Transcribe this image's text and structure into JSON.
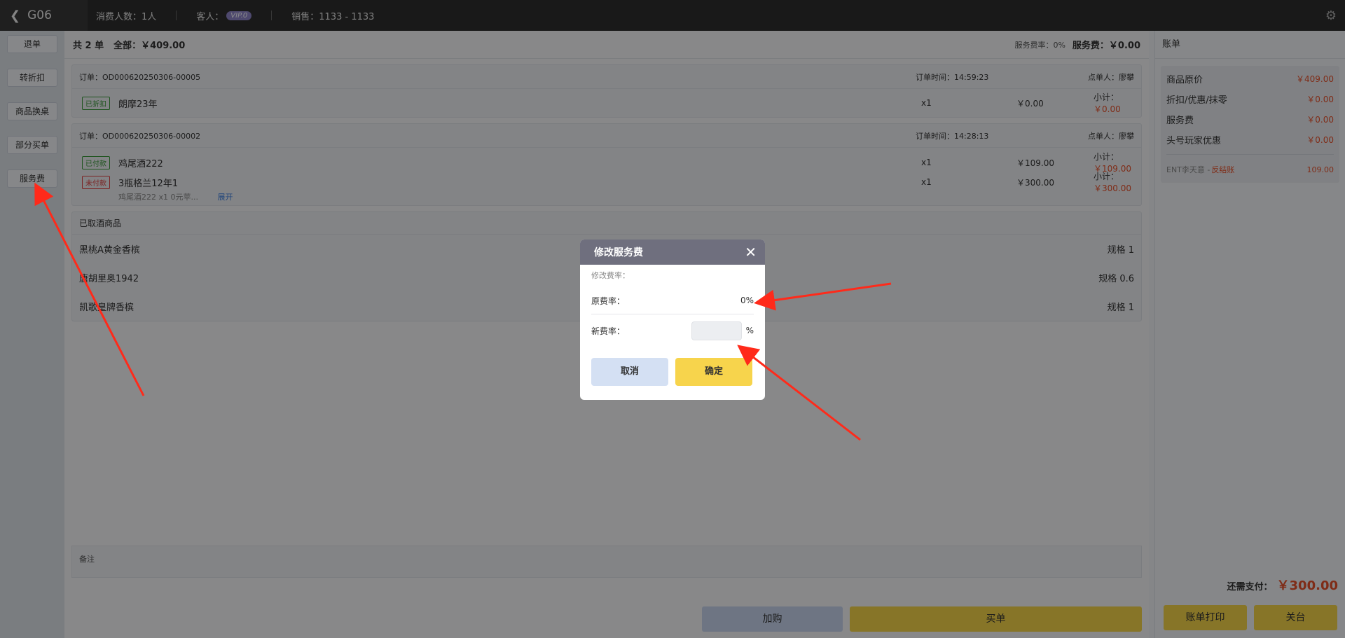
{
  "topbar": {
    "table": "G06",
    "guests_label": "消费人数：1人",
    "customer_label": "客人：",
    "vip_badge": "VIP.0",
    "sales_label": "销售：1133 - 1133"
  },
  "sidebar": {
    "items": [
      {
        "label": "退单"
      },
      {
        "label": "转折扣"
      },
      {
        "label": "商品换桌"
      },
      {
        "label": "部分买单"
      },
      {
        "label": "服务费"
      }
    ]
  },
  "summary": {
    "count": "共 2 单",
    "total": "全部：￥409.00",
    "service_rate": "服务费率：0%",
    "service_fee": "服务费：￥0.00"
  },
  "orders": [
    {
      "id": "订单：OD000620250306-00005",
      "time": "订单时间：14:59:23",
      "staff": "点单人：廖攀",
      "items": [
        {
          "tag": "已折扣",
          "tag_color": "green",
          "name": "朗摩23年",
          "qty": "x1",
          "price": "￥0.00",
          "sub_label": "小计：",
          "sub": "￥0.00"
        }
      ]
    },
    {
      "id": "订单：OD000620250306-00002",
      "time": "订单时间：14:28:13",
      "staff": "点单人：廖攀",
      "items": [
        {
          "tag": "已付款",
          "tag_color": "green",
          "name": "鸡尾酒222",
          "qty": "x1",
          "price": "￥109.00",
          "sub_label": "小计：",
          "sub": "￥109.00"
        },
        {
          "tag": "未付款",
          "tag_color": "red",
          "name": "3瓶格兰12年1",
          "qty": "x1",
          "price": "￥300.00",
          "sub_label": "小计：",
          "sub": "￥300.00"
        }
      ],
      "subline": "鸡尾酒222 x1   0元苹...",
      "expand": "展开"
    }
  ],
  "cancelled": {
    "title": "已取酒商品",
    "rows": [
      {
        "name": "黑桃A黄金香槟",
        "spec": "规格 1"
      },
      {
        "name": "唐胡里奥1942",
        "spec": "规格 0.6"
      },
      {
        "name": "凯歌皇牌香槟",
        "spec": "规格 1"
      }
    ]
  },
  "remarks_label": "备注",
  "actions": {
    "add": "加购",
    "checkout": "买单"
  },
  "bill": {
    "title": "账单",
    "rows": [
      {
        "label": "商品原价",
        "value": "￥409.00"
      },
      {
        "label": "折扣/优惠/抹零",
        "value": "￥0.00"
      },
      {
        "label": "服务费",
        "value": "￥0.00"
      },
      {
        "label": "头号玩家优惠",
        "value": "￥0.00"
      }
    ],
    "ent_label": "ENT李天意 - ",
    "ent_status": "反结账",
    "ent_value": "109.00",
    "pay_label": "还需支付：",
    "pay_amount": "￥300.00",
    "print": "账单打印",
    "close": "关台"
  },
  "modal": {
    "title": "修改服务费",
    "section_label": "修改费率：",
    "old_label": "原费率：",
    "old_value": "0%",
    "new_label": "新费率：",
    "new_value": "",
    "percent": "%",
    "cancel": "取消",
    "ok": "确定"
  },
  "colors": {
    "accent_yellow": "#f6d64a",
    "price_red": "#e8502a",
    "annotation_arrow": "#ff2a1a"
  }
}
